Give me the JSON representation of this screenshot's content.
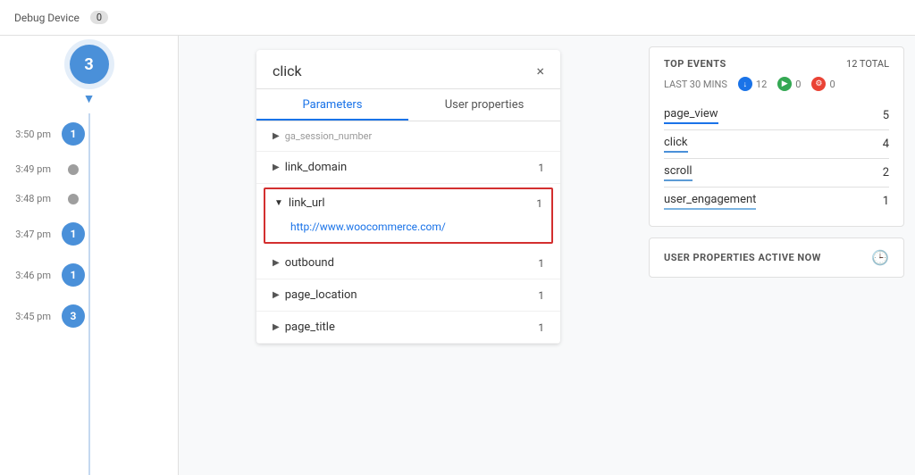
{
  "topbar": {
    "debug_label": "Debug Device",
    "debug_count": "0"
  },
  "timeline": {
    "top_count": "3",
    "entries": [
      {
        "time": "3:50 pm",
        "type": "circle",
        "count": "1"
      },
      {
        "time": "3:49 pm",
        "type": "dot"
      },
      {
        "time": "3:48 pm",
        "type": "dot"
      },
      {
        "time": "3:47 pm",
        "type": "circle",
        "count": "1"
      },
      {
        "time": "3:46 pm",
        "type": "circle",
        "count": "1"
      },
      {
        "time": "3:45 pm",
        "type": "circle",
        "count": "3"
      }
    ]
  },
  "event_card": {
    "title": "click",
    "close_symbol": "×",
    "tabs": [
      {
        "label": "Parameters",
        "active": true
      },
      {
        "label": "User properties",
        "active": false
      }
    ],
    "params": [
      {
        "id": "ga_session_number",
        "type": "truncated",
        "count": ""
      },
      {
        "id": "link_domain",
        "type": "collapsed",
        "count": "1"
      },
      {
        "id": "link_url",
        "type": "expanded",
        "count": "1",
        "value": "http://www.woocommerce.com/",
        "highlighted": true
      },
      {
        "id": "outbound",
        "type": "collapsed",
        "count": "1"
      },
      {
        "id": "page_location",
        "type": "collapsed",
        "count": "1"
      },
      {
        "id": "page_title",
        "type": "collapsed",
        "count": "1"
      }
    ]
  },
  "top_events": {
    "title": "TOP EVENTS",
    "total_label": "12 TOTAL",
    "subheader_label": "LAST 30 MINS",
    "badges": [
      {
        "color": "blue",
        "icon": "↓",
        "count": "12"
      },
      {
        "color": "green",
        "icon": "▶",
        "count": "0"
      },
      {
        "color": "red",
        "icon": "⚙",
        "count": "0"
      }
    ],
    "events": [
      {
        "name": "page_view",
        "count": "5",
        "underline": "1"
      },
      {
        "name": "click",
        "count": "4",
        "underline": "2"
      },
      {
        "name": "scroll",
        "count": "2",
        "underline": "3"
      },
      {
        "name": "user_engagement",
        "count": "1",
        "underline": "4"
      }
    ]
  },
  "user_properties": {
    "title": "USER PROPERTIES ACTIVE NOW"
  }
}
